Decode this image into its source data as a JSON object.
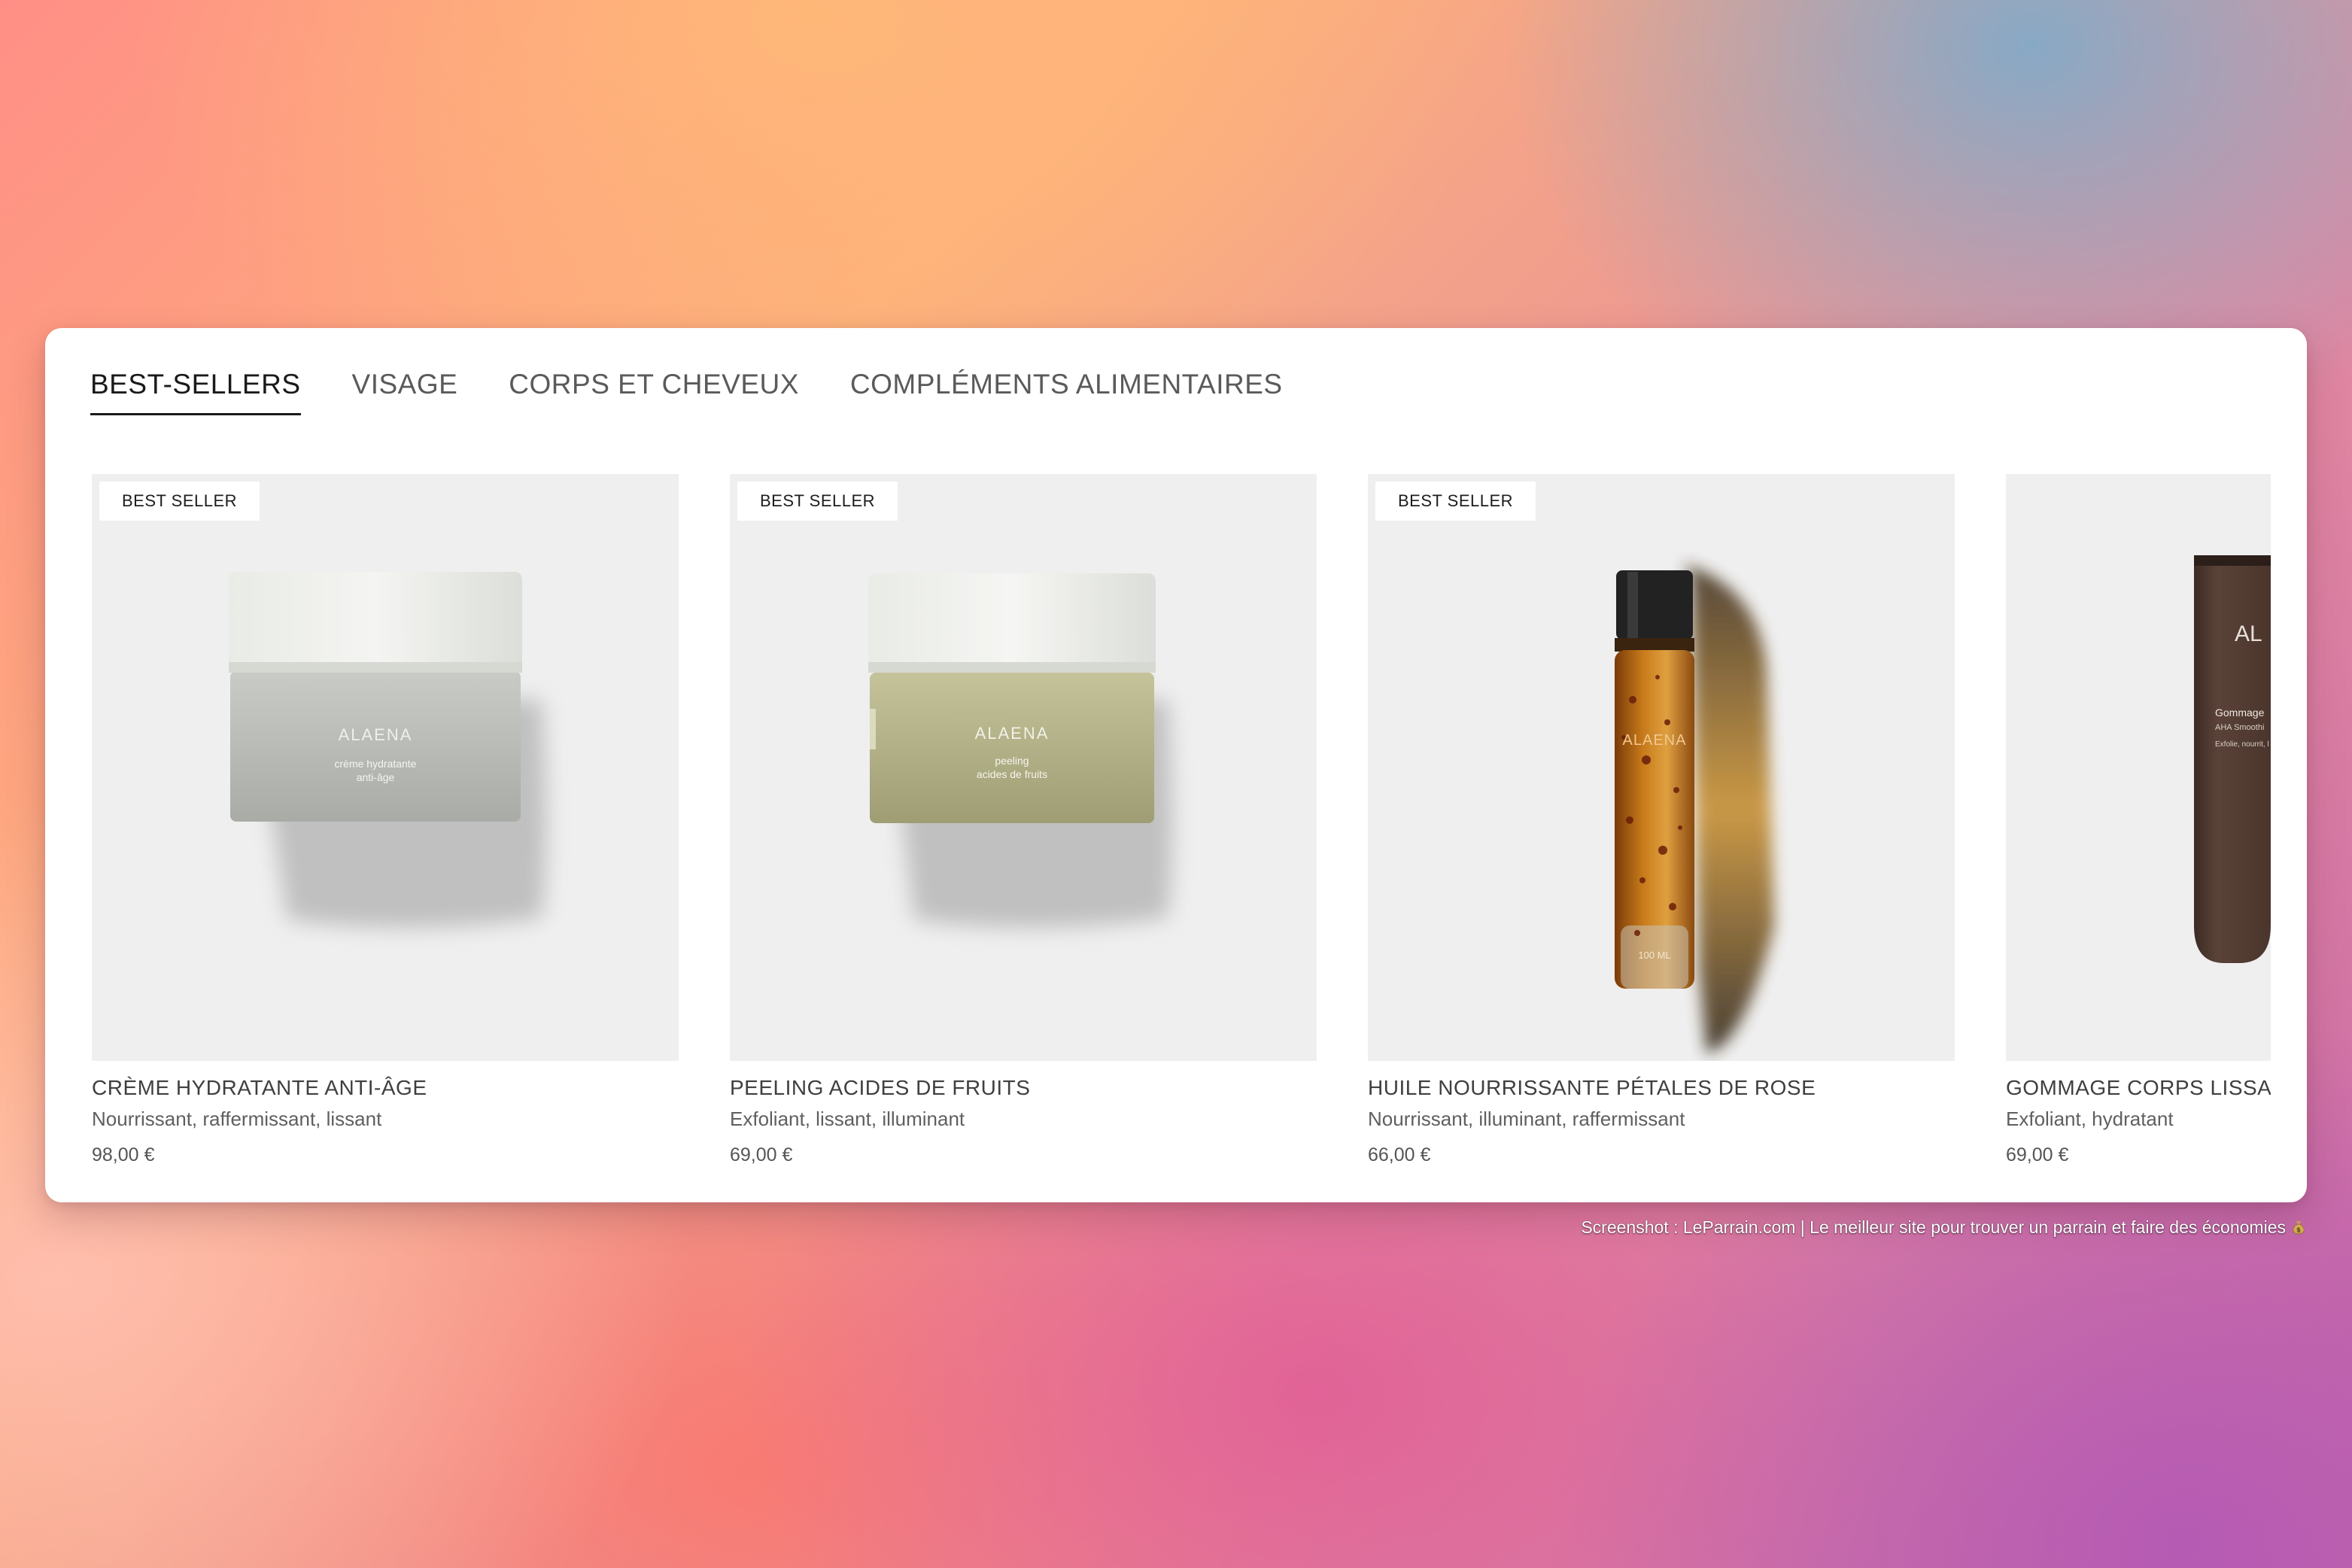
{
  "tabs": [
    {
      "label": "BEST-SELLERS",
      "active": true
    },
    {
      "label": "VISAGE",
      "active": false
    },
    {
      "label": "CORPS ET CHEVEUX",
      "active": false
    },
    {
      "label": "COMPLÉMENTS ALIMENTAIRES",
      "active": false
    }
  ],
  "products": [
    {
      "badge": "BEST SELLER",
      "name": "CRÈME HYDRATANTE ANTI-ÂGE",
      "desc": "Nourrissant, raffermissant, lissant",
      "price": "98,00 €",
      "image": {
        "brand": "ALAENA",
        "line1": "crème hydratante",
        "line2": "anti-âge",
        "icon": "cream-jar-image"
      }
    },
    {
      "badge": "BEST SELLER",
      "name": "PEELING ACIDES DE FRUITS",
      "desc": "Exfoliant, lissant, illuminant",
      "price": "69,00 €",
      "image": {
        "brand": "ALAENA",
        "line1": "peeling",
        "line2": "acides de fruits",
        "icon": "peeling-jar-image"
      }
    },
    {
      "badge": "BEST SELLER",
      "name": "HUILE NOURRISSANTE PÉTALES DE ROSE",
      "desc": "Nourrissant, illuminant, raffermissant",
      "price": "66,00 €",
      "image": {
        "brand": "ALAENA",
        "volume": "100 ML",
        "icon": "oil-bottle-image"
      }
    },
    {
      "badge": "",
      "name": "GOMMAGE CORPS LISSANT",
      "desc": "Exfoliant, hydratant",
      "price": "69,00 €",
      "image": {
        "brand": "AL",
        "line1": "Gommage",
        "line2": "AHA Smoothi",
        "line3": "Exfolie, nourrit, l",
        "icon": "scrub-tube-image"
      }
    }
  ],
  "credit": "Screenshot : LeParrain.com | Le meilleur site pour trouver un parrain et faire des économies",
  "colors": {
    "panel": "#ffffff",
    "image_bg": "#efefef",
    "text_dark": "#1a1a1a",
    "text_muted": "#5f5f5f"
  }
}
